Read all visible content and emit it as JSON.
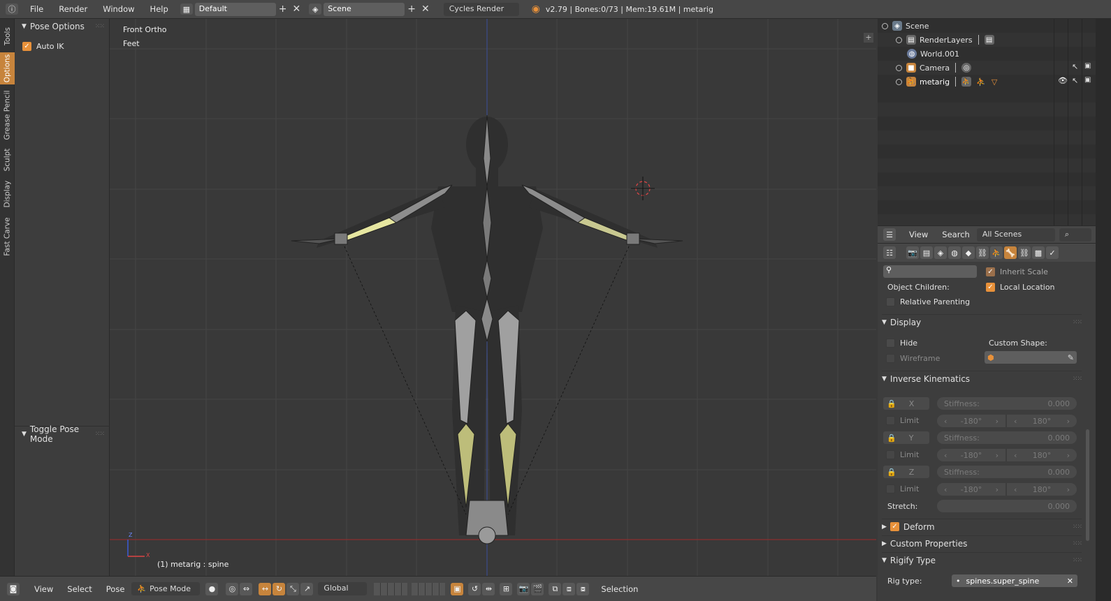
{
  "topbar": {
    "menus": [
      "File",
      "Render",
      "Window",
      "Help"
    ],
    "layout": "Default",
    "scene": "Scene",
    "engine": "Cycles Render",
    "stats": "v2.79 | Bones:0/73 | Mem:19.61M | metarig"
  },
  "tooltabs": [
    "Tools",
    "Options",
    "Grease Pencil",
    "Sculpt",
    "Display",
    "Fast Carve"
  ],
  "toolshelf": {
    "pose_options_title": "Pose Options",
    "auto_ik_label": "Auto IK",
    "toggle_pose_mode": "Toggle Pose Mode"
  },
  "viewport": {
    "view_name": "Front Ortho",
    "units": "Feet",
    "object_info": "(1) metarig : spine",
    "axis_z": "Z",
    "axis_x": "X"
  },
  "bottombar": {
    "menus": [
      "View",
      "Select",
      "Pose"
    ],
    "mode": "Pose Mode",
    "orientation": "Global",
    "selection_label": "Selection"
  },
  "outliner": {
    "rows": [
      {
        "name": "Scene",
        "icon": "scene-icon"
      },
      {
        "name": "RenderLayers",
        "icon": "renderlayers-icon"
      },
      {
        "name": "World.001",
        "icon": "world-icon"
      },
      {
        "name": "Camera",
        "icon": "camera-icon"
      },
      {
        "name": "metarig",
        "icon": "armature-icon"
      }
    ],
    "header": {
      "view": "View",
      "search": "Search",
      "filter": "All Scenes"
    }
  },
  "properties": {
    "inherit_scale": "Inherit Scale",
    "object_children": "Object Children:",
    "local_location": "Local Location",
    "relative_parenting": "Relative Parenting",
    "display_title": "Display",
    "hide": "Hide",
    "custom_shape": "Custom Shape:",
    "wireframe": "Wireframe",
    "ik_title": "Inverse Kinematics",
    "ik_rows": [
      {
        "axis": "X",
        "stiffness_label": "Stiffness:",
        "stiffness": "0.000",
        "limit": "Limit",
        "min": "-180°",
        "max": "180°"
      },
      {
        "axis": "Y",
        "stiffness_label": "Stiffness:",
        "stiffness": "0.000",
        "limit": "Limit",
        "min": "-180°",
        "max": "180°"
      },
      {
        "axis": "Z",
        "stiffness_label": "Stiffness:",
        "stiffness": "0.000",
        "limit": "Limit",
        "min": "-180°",
        "max": "180°"
      }
    ],
    "stretch_label": "Stretch:",
    "stretch_value": "0.000",
    "deform_title": "Deform",
    "custom_props_title": "Custom Properties",
    "rigify_title": "Rigify Type",
    "rig_type_label": "Rig type:",
    "rig_type_value": "spines.super_spine"
  },
  "colors": {
    "accent": "#e8913a",
    "bone_selected": "#e6e6a0",
    "bone_gray": "#9a9a9a",
    "header_bg": "#474747",
    "viewport_bg": "#393939"
  }
}
